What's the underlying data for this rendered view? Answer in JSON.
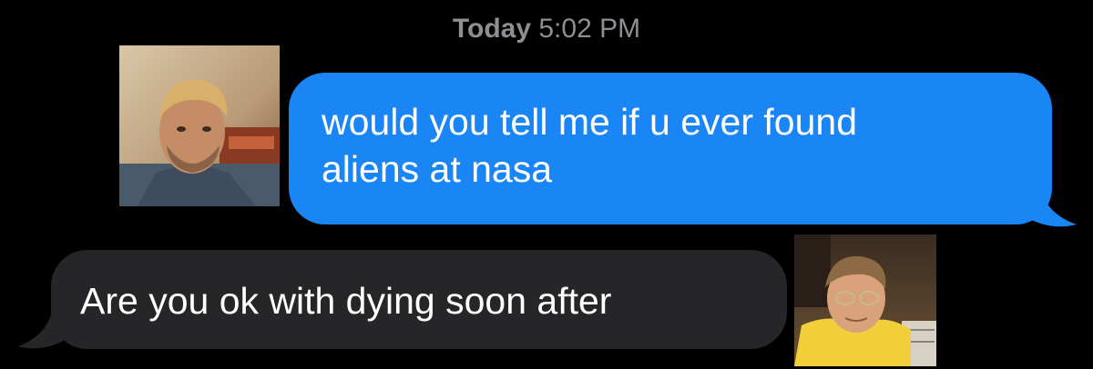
{
  "conversation": {
    "timestamp_day": "Today",
    "timestamp_time": "5:02 PM",
    "messages": [
      {
        "direction": "outgoing",
        "line1": "would you tell me if u ever found",
        "line2": "aliens at nasa"
      },
      {
        "direction": "incoming",
        "text": "Are you ok with dying soon after"
      }
    ]
  },
  "avatars": [
    {
      "icon": "person-photo-desert"
    },
    {
      "icon": "person-photo-yellow-shirt"
    }
  ],
  "colors": {
    "background": "#000000",
    "outgoing_bubble": "#1a86f6",
    "incoming_bubble": "#262629",
    "timestamp": "#8e8e93",
    "message_text": "#ffffff"
  }
}
